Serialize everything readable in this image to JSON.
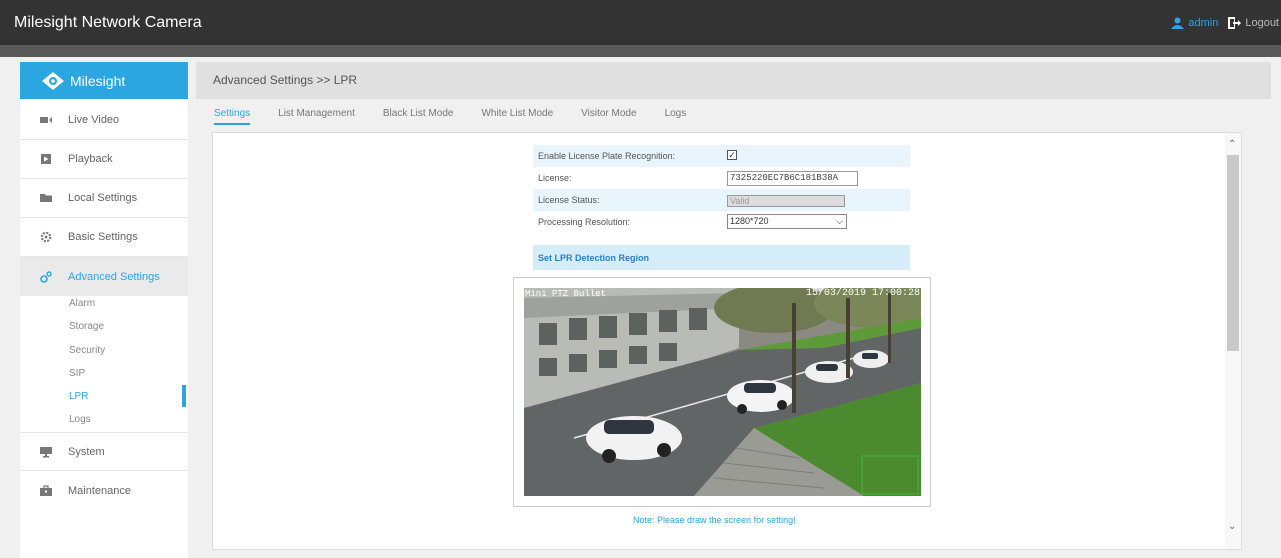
{
  "app": {
    "title": "Milesight Network Camera"
  },
  "user": {
    "name": "admin",
    "logout_label": "Logout"
  },
  "brand": {
    "logo_text": "Milesight",
    "accent": "#2ba6e1"
  },
  "sidebar": {
    "items": [
      {
        "label": "Live Video",
        "icon": "video-icon"
      },
      {
        "label": "Playback",
        "icon": "playback-icon"
      },
      {
        "label": "Local Settings",
        "icon": "folder-icon"
      },
      {
        "label": "Basic Settings",
        "icon": "gear-icon"
      },
      {
        "label": "Advanced Settings",
        "icon": "advanced-icon",
        "active": true
      },
      {
        "label": "System",
        "icon": "monitor-icon"
      },
      {
        "label": "Maintenance",
        "icon": "toolbox-icon"
      }
    ],
    "sub_items": [
      "Alarm",
      "Storage",
      "Security",
      "SIP",
      "LPR",
      "Logs"
    ],
    "active_sub": "LPR"
  },
  "header": {
    "breadcrumb": "Advanced Settings >> LPR"
  },
  "tabs": [
    {
      "label": "Settings",
      "active": true
    },
    {
      "label": "List Management"
    },
    {
      "label": "Black List Mode"
    },
    {
      "label": "White List Mode"
    },
    {
      "label": "Visitor Mode"
    },
    {
      "label": "Logs"
    }
  ],
  "form": {
    "enable_label": "Enable License Plate Recognition:",
    "enable_checked": true,
    "license_label": "License:",
    "license_value": "7325220EC7B6C181B38A",
    "status_label": "License Status:",
    "status_value": "Valid",
    "resolution_label": "Processing Resolution:",
    "resolution_value": "1280*720"
  },
  "detection": {
    "section_title": "Set LPR Detection Region",
    "osd_name": "Mini PTZ Bullet",
    "osd_time": "15/03/2019 17:00:28",
    "note": "Note: Please draw the screen for setting!"
  }
}
